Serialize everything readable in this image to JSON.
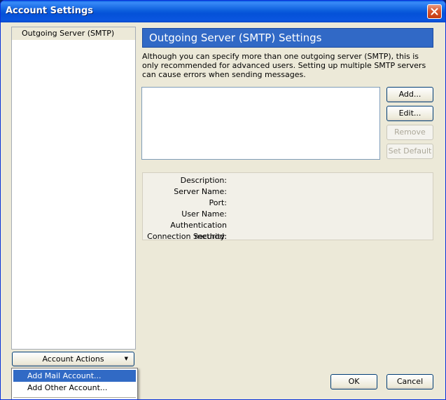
{
  "window": {
    "title": "Account Settings"
  },
  "tree": {
    "items": [
      {
        "label": "Outgoing Server (SMTP)"
      }
    ]
  },
  "account_actions": {
    "label": "Account Actions",
    "menu": [
      {
        "label": "Add Mail Account..."
      },
      {
        "label": "Add Other Account..."
      }
    ]
  },
  "panel": {
    "title": "Outgoing Server (SMTP) Settings",
    "description": "Although you can specify more than one outgoing server (SMTP), this is only recommended for advanced users. Setting up multiple SMTP servers can cause errors when sending messages."
  },
  "buttons": {
    "add": "Add...",
    "edit": "Edit...",
    "remove": "Remove",
    "set_default": "Set Default",
    "ok": "OK",
    "cancel": "Cancel"
  },
  "details": {
    "description_label": "Description:",
    "server_name_label": "Server Name:",
    "port_label": "Port:",
    "user_name_label": "User Name:",
    "auth_method_label": "Authentication method:",
    "connection_security_label": "Connection Security:"
  },
  "colors": {
    "title_bar": "#0d5fdd",
    "panel_header": "#3169c6",
    "selection": "#316ac5"
  },
  "icons": {
    "close": "close-icon",
    "dropdown": "triangle-down-icon"
  }
}
